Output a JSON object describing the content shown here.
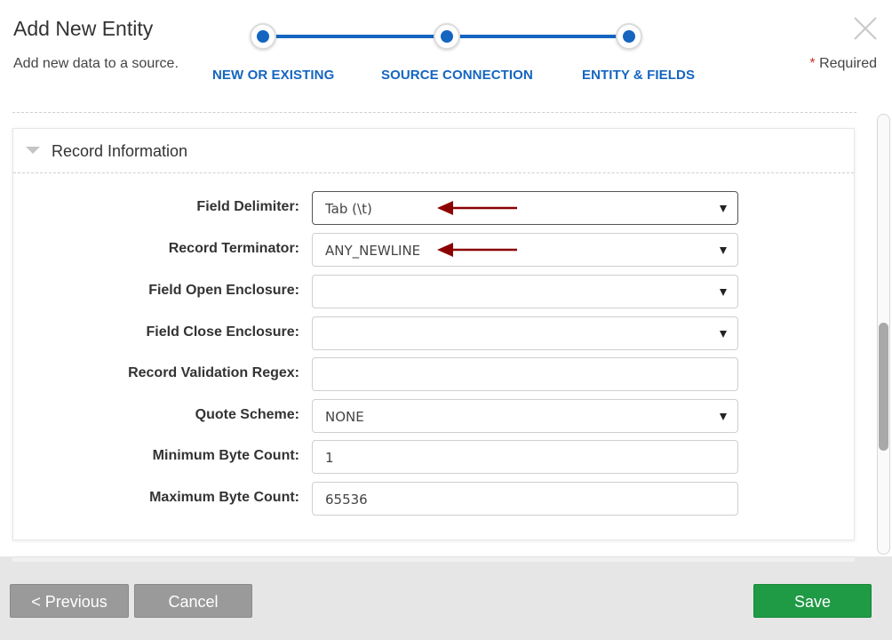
{
  "header": {
    "title": "Add New Entity",
    "subtitle": "Add new data to a source.",
    "required_star": "*",
    "required_text": " Required"
  },
  "stepper": {
    "steps": [
      {
        "label": "NEW OR EXISTING"
      },
      {
        "label": "SOURCE CONNECTION"
      },
      {
        "label": "ENTITY & FIELDS"
      }
    ],
    "accent_color": "#1565c0"
  },
  "section": {
    "title": "Record Information",
    "expanded": true
  },
  "fields": {
    "field_delimiter": {
      "label": "Field Delimiter:",
      "value": "Tab (\\t)",
      "type": "select",
      "highlighted": true
    },
    "record_terminator": {
      "label": "Record Terminator:",
      "value": "ANY_NEWLINE",
      "type": "select",
      "highlighted": true
    },
    "field_open_enclosure": {
      "label": "Field Open Enclosure:",
      "value": "",
      "type": "select"
    },
    "field_close_enclosure": {
      "label": "Field Close Enclosure:",
      "value": "",
      "type": "select"
    },
    "record_validation_regex": {
      "label": "Record Validation Regex:",
      "value": "",
      "type": "text"
    },
    "quote_scheme": {
      "label": "Quote Scheme:",
      "value": "NONE",
      "type": "select"
    },
    "minimum_byte_count": {
      "label": "Minimum Byte Count:",
      "value": "1",
      "type": "text"
    },
    "maximum_byte_count": {
      "label": "Maximum Byte Count:",
      "value": "65536",
      "type": "text"
    }
  },
  "annotation_arrow_color": "#8b0000",
  "footer": {
    "previous_label": "< Previous",
    "cancel_label": "Cancel",
    "save_label": "Save",
    "save_color": "#1f9a45"
  }
}
